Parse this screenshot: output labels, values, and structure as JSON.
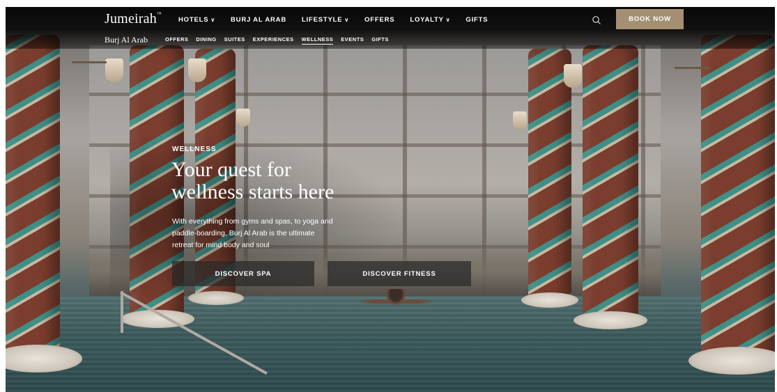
{
  "brand": {
    "logo_text": "Jumeirah",
    "logo_mark": "™",
    "property_name": "Burj Al Arab"
  },
  "main_nav": {
    "items": [
      {
        "label": "HOTELS",
        "has_dropdown": true
      },
      {
        "label": "BURJ AL ARAB",
        "has_dropdown": false
      },
      {
        "label": "LIFESTYLE",
        "has_dropdown": true
      },
      {
        "label": "OFFERS",
        "has_dropdown": false
      },
      {
        "label": "LOYALTY",
        "has_dropdown": true
      },
      {
        "label": "GIFTS",
        "has_dropdown": false
      }
    ],
    "search_icon": "search-icon",
    "book_label": "BOOK NOW",
    "book_color": "#a48f73"
  },
  "sub_nav": {
    "items": [
      "OFFERS",
      "DINING",
      "SUITES",
      "EXPERIENCES",
      "WELLNESS",
      "EVENTS",
      "GIFTS"
    ],
    "active": "WELLNESS"
  },
  "hero": {
    "eyebrow": "WELLNESS",
    "headline_line1": "Your quest for",
    "headline_line2": "wellness starts here",
    "intro_line1": "With everything from gyms and spas, to yoga and",
    "intro_line2": "paddle-boarding, Burj Al Arab is the ultimate",
    "intro_line3": "retreat for mind body and soul",
    "cta_spa": "DISCOVER SPA",
    "cta_fitness": "DISCOVER FITNESS"
  }
}
